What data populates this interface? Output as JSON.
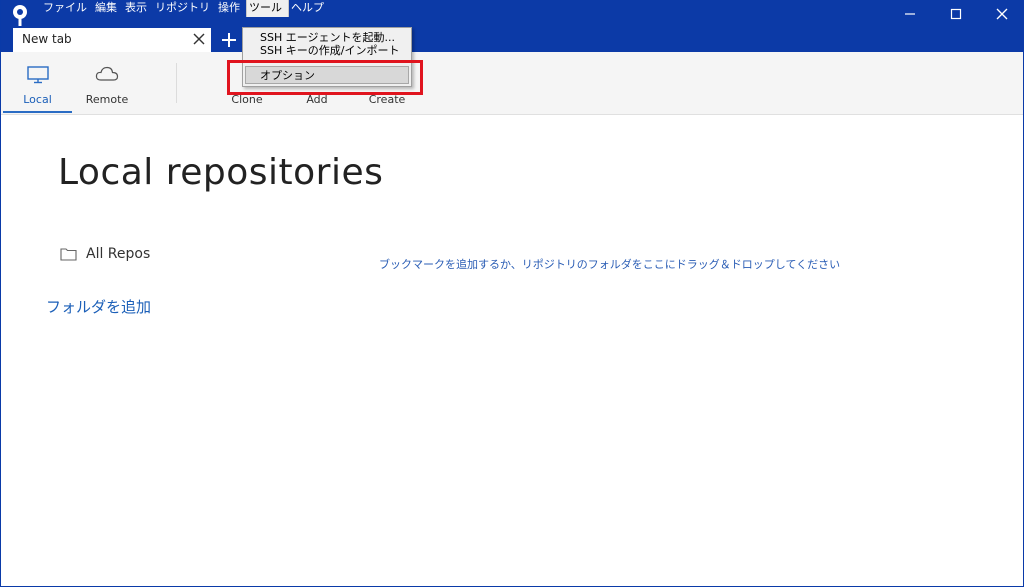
{
  "colors": {
    "titlebar": "#0c3aa7",
    "link": "#1b5fb8",
    "highlight": "#e0141e"
  },
  "menubar": {
    "items": [
      {
        "label": "ファイル"
      },
      {
        "label": "編集"
      },
      {
        "label": "表示"
      },
      {
        "label": "リポジトリ"
      },
      {
        "label": "操作"
      },
      {
        "label": "ツール"
      },
      {
        "label": "ヘルプ"
      }
    ]
  },
  "window_controls": {
    "minimize_icon": "minimize-icon",
    "maximize_icon": "maximize-icon",
    "close_icon": "close-icon"
  },
  "tabs": {
    "active_label": "New tab",
    "add_icon": "plus-icon"
  },
  "toolbar": {
    "local": "Local",
    "remote": "Remote",
    "clone": "Clone",
    "add": "Add",
    "create": "Create"
  },
  "tools_menu": {
    "items": [
      {
        "label": "SSH エージェントを起動..."
      },
      {
        "label": "SSH キーの作成/インポート"
      },
      {
        "label": "オプション"
      }
    ]
  },
  "main": {
    "title": "Local repositories",
    "all_repos": "All Repos",
    "add_folder": "フォルダを追加",
    "hint": "ブックマークを追加するか、リポジトリのフォルダをここにドラッグ＆ドロップしてください"
  }
}
